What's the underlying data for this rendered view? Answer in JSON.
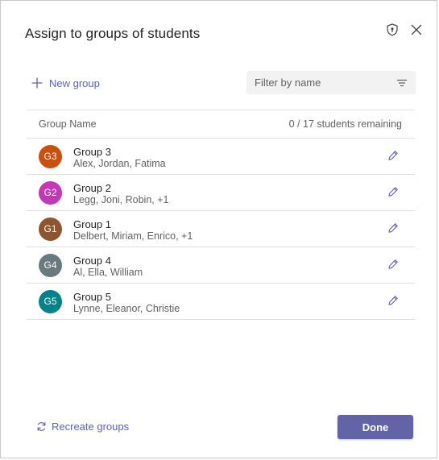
{
  "dialog": {
    "title": "Assign to groups of students"
  },
  "header_icons": [
    "shield-icon",
    "close-icon"
  ],
  "toolbar": {
    "new_group_label": "New group",
    "filter_placeholder": "Filter by name",
    "filter_value": ""
  },
  "table": {
    "column_header": "Group Name",
    "remaining": "0 / 17 students remaining",
    "rows": [
      {
        "initials": "G3",
        "name": "Group 3",
        "members": "Alex, Jordan, Fatima",
        "color": "#ca5010"
      },
      {
        "initials": "G2",
        "name": "Group 2",
        "members": "Legg, Joni, Robin, +1",
        "color": "#c239b3"
      },
      {
        "initials": "G1",
        "name": "Group 1",
        "members": "Delbert, Miriam, Enrico, +1",
        "color": "#8e562e"
      },
      {
        "initials": "G4",
        "name": "Group 4",
        "members": "Al, Ella, William",
        "color": "#69797e"
      },
      {
        "initials": "G5",
        "name": "Group 5",
        "members": "Lynne, Eleanor, Christie",
        "color": "#038387"
      }
    ]
  },
  "footer": {
    "recreate_label": "Recreate groups",
    "done_label": "Done"
  },
  "colors": {
    "accent": "#5b5fc7",
    "primary_button": "#6264a7"
  }
}
